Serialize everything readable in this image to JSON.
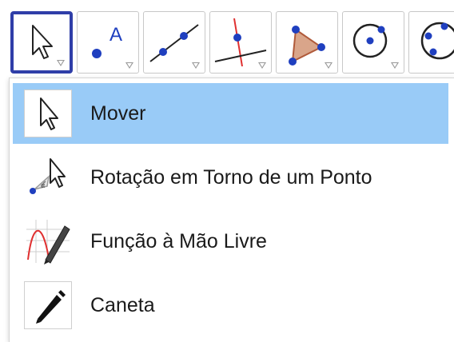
{
  "toolbar": {
    "tools": [
      {
        "name": "move",
        "icon": "cursor-arrow-icon",
        "selected": true
      },
      {
        "name": "point",
        "icon": "point-icon",
        "letter": "A"
      },
      {
        "name": "line",
        "icon": "line-through-points-icon"
      },
      {
        "name": "perpendicular",
        "icon": "perpendicular-line-icon"
      },
      {
        "name": "polygon",
        "icon": "polygon-icon"
      },
      {
        "name": "circle",
        "icon": "circle-center-point-icon"
      },
      {
        "name": "circle-three-points",
        "icon": "circle-three-points-icon"
      }
    ]
  },
  "menu": {
    "items": [
      {
        "label": "Mover",
        "icon": "cursor-arrow-icon",
        "active": true
      },
      {
        "label": "Rotação em Torno de um Ponto",
        "icon": "rotate-around-point-icon",
        "active": false
      },
      {
        "label": "Função à Mão Livre",
        "icon": "freehand-function-icon",
        "active": false
      },
      {
        "label": "Caneta",
        "icon": "pen-icon",
        "active": false
      }
    ]
  },
  "colors": {
    "selected_border": "#2f3ea8",
    "active_item_bg": "#99cbf7",
    "point_blue": "#1f3fbf",
    "polygon_fill": "#d9a58a",
    "perpendicular_red": "#e03030"
  }
}
